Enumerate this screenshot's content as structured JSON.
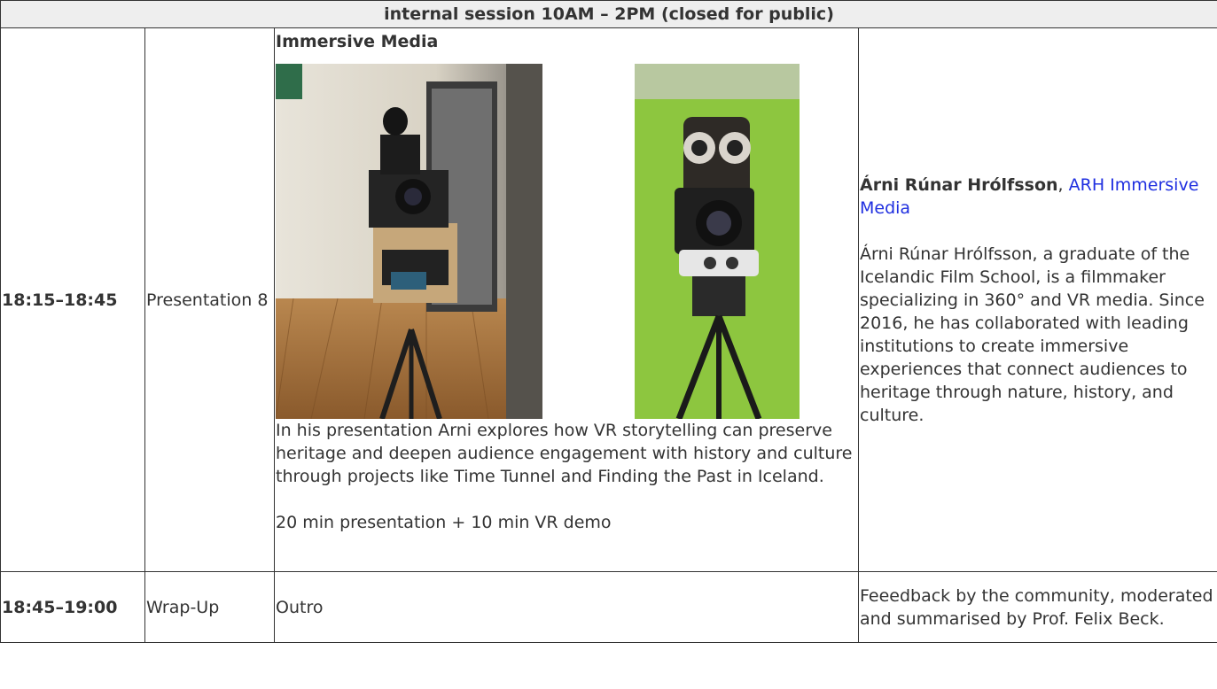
{
  "header": {
    "text": "internal session 10AM – 2PM (closed for public)"
  },
  "rows": [
    {
      "time": "18:15–18:45",
      "type": "Presentation 8",
      "title": "Immersive Media",
      "description": "In his presentation Arni explores how VR storytelling can preserve heritage and deepen audience engagement with history and culture through projects like Time Tunnel and Finding the Past in Iceland.",
      "duration": "20 min presentation + 10 min VR demo",
      "speaker": {
        "name": "Árni Rúnar Hrólfsson",
        "separator": ",",
        "org_link": "ARH Immersive Media",
        "bio": "Árni Rúnar Hrólfsson, a graduate of the Icelandic Film School, is a filmmaker specializing in 360° and VR media. Since 2016, he has collaborated with leading institutions to create immersive experiences that connect audiences to heritage through nature, history, and culture."
      }
    },
    {
      "time": "18:45–19:00",
      "type": "Wrap-Up",
      "title": "Outro",
      "speaker_text": "Feeedback by the community, moderated and summarised by Prof. Felix Beck."
    }
  ],
  "colors": {
    "border": "#333333",
    "header_bg": "#eeeeee",
    "link": "#1f2fe0",
    "green_screen": "#8dc63f"
  }
}
